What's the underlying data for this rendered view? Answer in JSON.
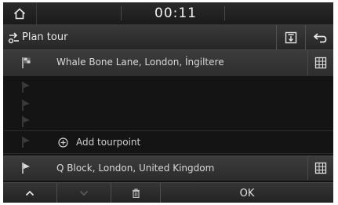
{
  "status_bar": {
    "time": "00:11",
    "home_icon": "home-icon"
  },
  "title_bar": {
    "title": "Plan tour",
    "route_icon": "route-icon",
    "buttons": [
      {
        "icon": "save-icon"
      },
      {
        "icon": "back-icon"
      }
    ]
  },
  "tour": {
    "start": {
      "address": "Whale Bone Lane, London, İngiltere",
      "icon": "start-flag-icon",
      "map_icon": "map-icon"
    },
    "empty_waypoints": [
      {
        "icon": "waypoint-flag-icon"
      },
      {
        "icon": "waypoint-flag-icon"
      },
      {
        "icon": "waypoint-flag-icon"
      }
    ],
    "add": {
      "label": "Add tourpoint",
      "icon": "add-circle-icon"
    },
    "destination": {
      "address": "Q Block, London, United Kingdom",
      "icon": "destination-flag-icon",
      "map_icon": "map-icon"
    }
  },
  "bottom_bar": {
    "up_icon": "chevron-up-icon",
    "down_icon": "chevron-down-icon",
    "delete_icon": "trash-icon",
    "ok_label": "OK"
  }
}
